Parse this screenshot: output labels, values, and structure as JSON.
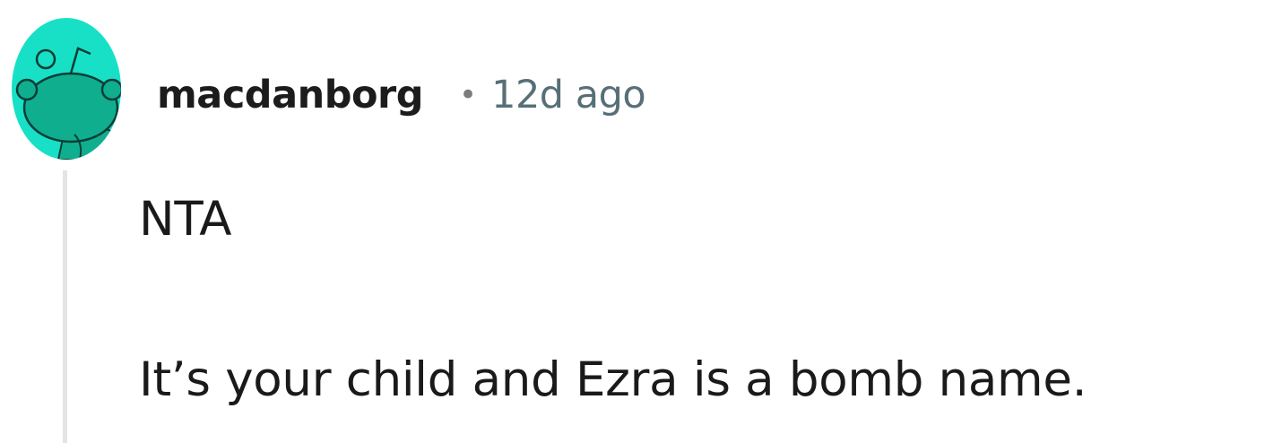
{
  "comment": {
    "author": "macdanborg",
    "separator": "•",
    "timestamp": "12d ago",
    "body_lines": [
      "NTA",
      "It’s your child and Ezra is a bomb name."
    ]
  },
  "colors": {
    "avatar_background": "#17e0c7",
    "avatar_figure": "#0fae8f",
    "username": "#1c1c1c",
    "timestamp": "#576f76",
    "thread_line": "#e4e4e4"
  },
  "icons": {
    "avatar": "reddit-snoo-avatar-icon"
  }
}
